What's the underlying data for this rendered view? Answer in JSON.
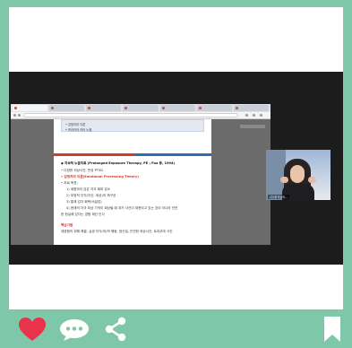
{
  "colors": {
    "frame": "#7ec8a9",
    "heart": "#e8334a",
    "icon": "#ffffff",
    "accent_red": "#d8382b",
    "accent_blue": "#2d6db5"
  },
  "document": {
    "top_item_1": "• 감정처리 이론",
    "top_item_2": "• 프라이어 카타 노출",
    "heading": "◆ 지속적 노출치료 (Prolonged Exposure Therapy, PE ; Foa 등, 1994)",
    "line1": "• 다양한 외상사건, 만성 PTSD",
    "line2": "• 감정처리 이론(Emotional Processing Theory)",
    "line3": "• 치료 목표:",
    "line4": "1) 위험하지 않은 자극 회피 감소",
    "line5": "2) 부정적 인지(자신, 세상)의 재구성",
    "line6": "3) 통제 감각 회복(숙달감)",
    "line7": "4) 현재의 자극 외상 기억이 회상될 때 과거 사건이 재현되고 있는 것이 아니라 안전",
    "line8": "한 현실에 있다는 경험 재인 인식",
    "section": "핵심기법",
    "line9": "재경험의 위해 해결, 실생 지각(외)적 행동, 정신질, 안전한 외상사건, 트라우마 사건"
  },
  "webcam": {
    "label": "(주)한국심리..."
  },
  "footer": {
    "icons": [
      "heart-icon",
      "comment-icon",
      "share-icon",
      "bookmark-icon"
    ]
  }
}
